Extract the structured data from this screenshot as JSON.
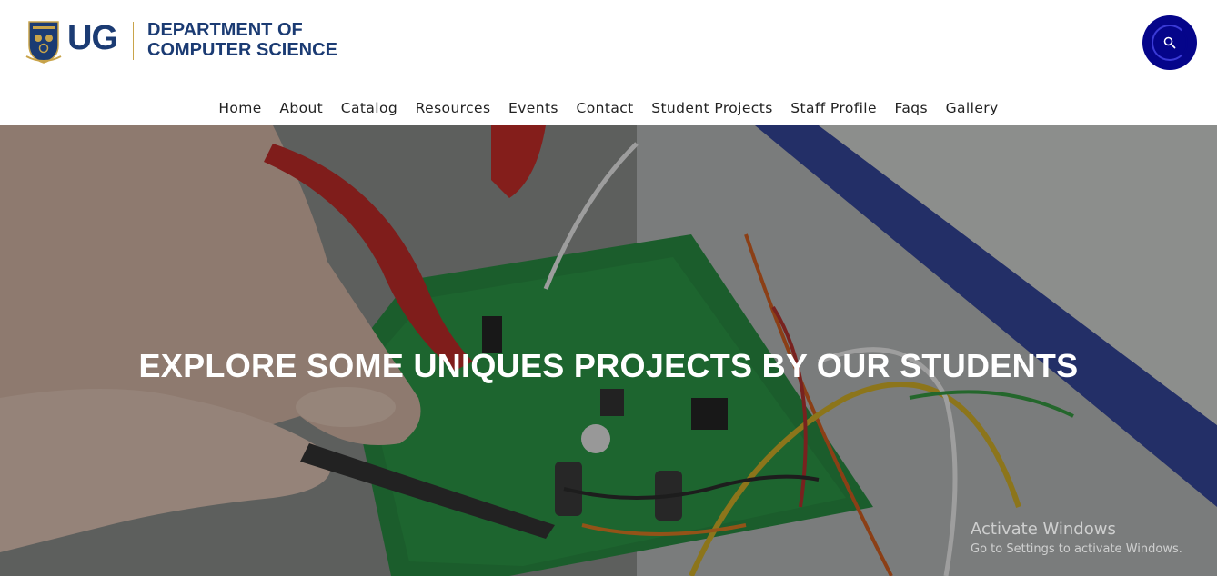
{
  "brand": {
    "short": "UG",
    "line1": "DEPARTMENT OF",
    "line2": "COMPUTER SCIENCE"
  },
  "search": {
    "icon": "search-icon"
  },
  "nav": {
    "items": [
      {
        "label": "Home"
      },
      {
        "label": "About"
      },
      {
        "label": "Catalog"
      },
      {
        "label": "Resources"
      },
      {
        "label": "Events"
      },
      {
        "label": "Contact"
      },
      {
        "label": "Student Projects"
      },
      {
        "label": "Staff Profile"
      },
      {
        "label": "Faqs"
      },
      {
        "label": "Gallery"
      }
    ]
  },
  "hero": {
    "title": "EXPLORE SOME UNIQUES PROJECTS BY OUR STUDENTS"
  },
  "watermark": {
    "title": "Activate Windows",
    "subtitle": "Go to Settings to activate Windows."
  },
  "colors": {
    "brand_blue": "#1b3b73",
    "search_button": "#05058a",
    "nav_text": "#222222"
  }
}
